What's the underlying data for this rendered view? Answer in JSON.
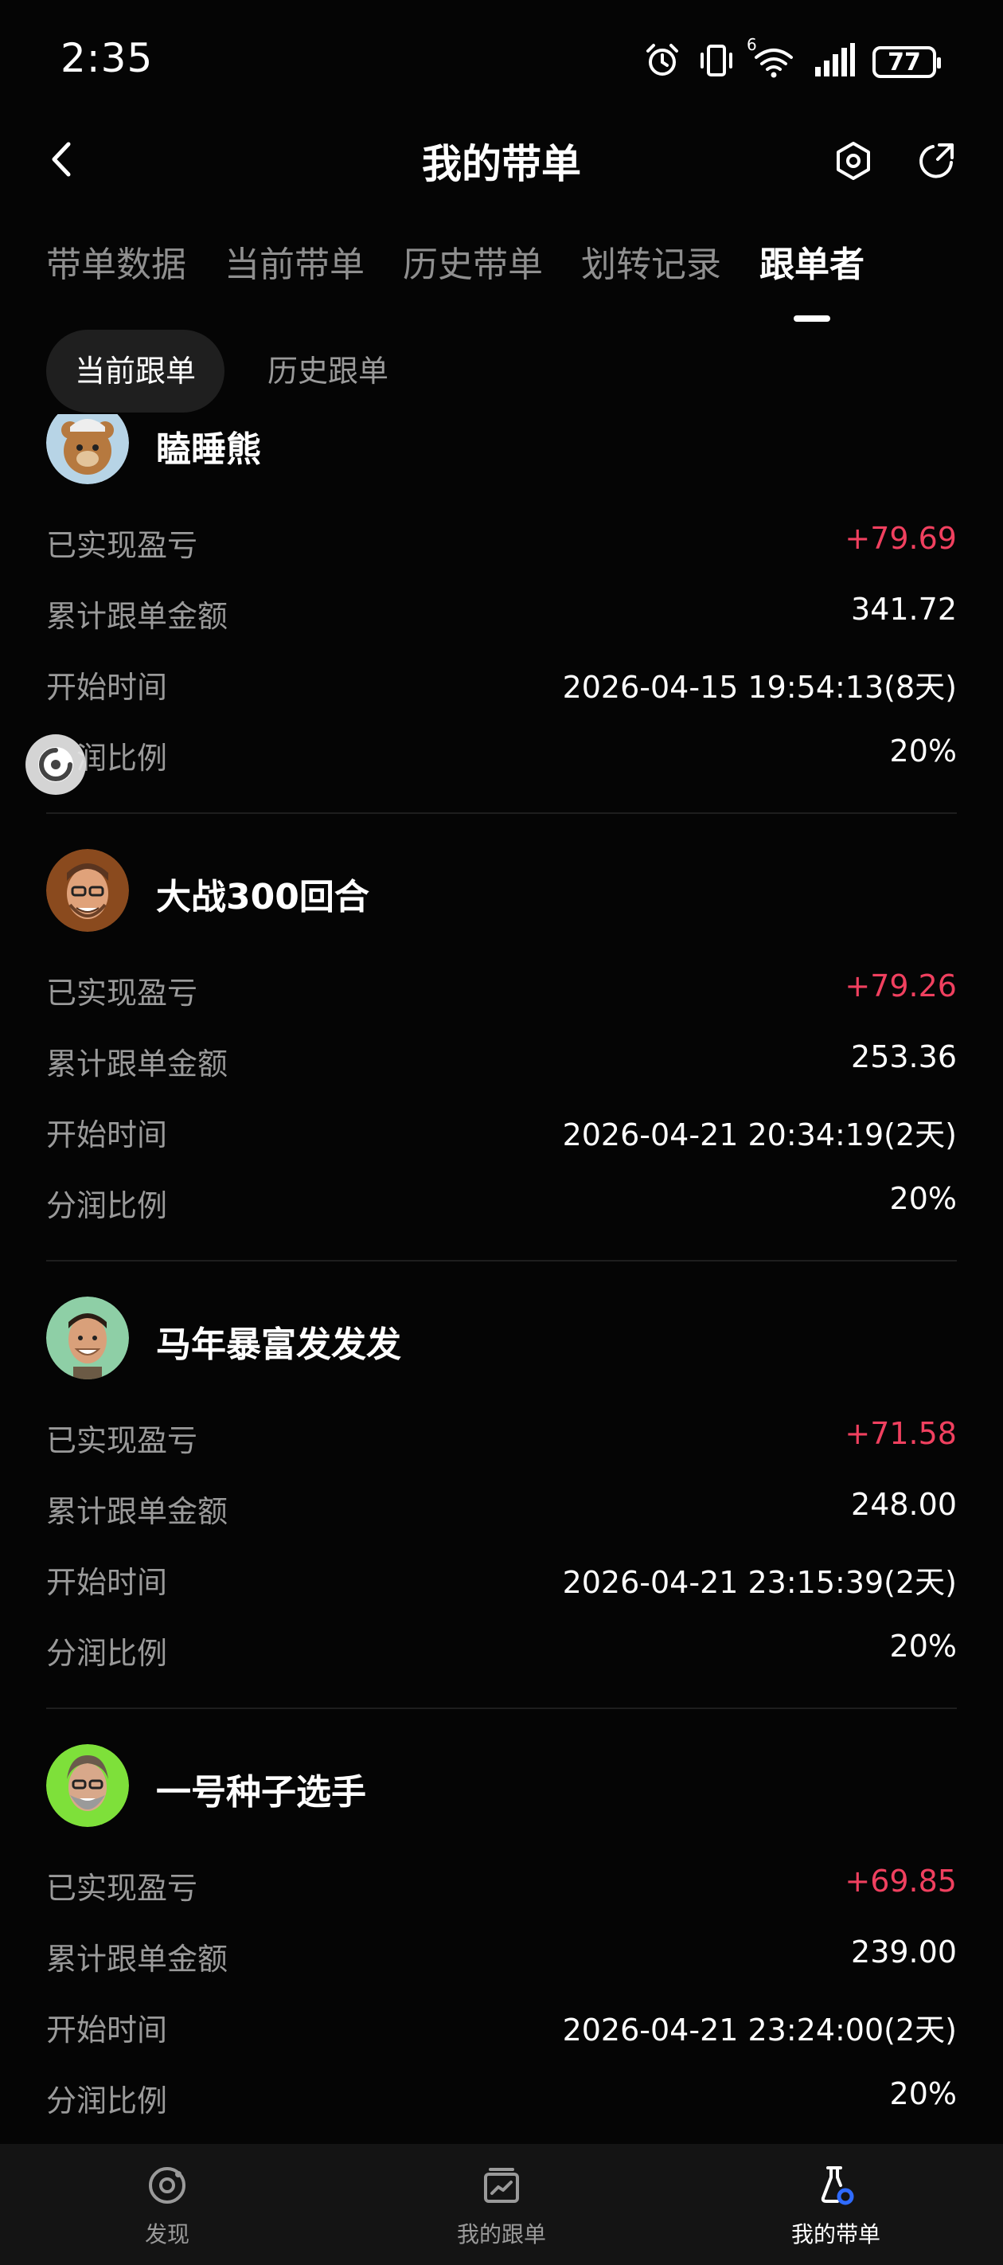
{
  "status": {
    "time": "2:35",
    "battery": "77",
    "net_badge": "6"
  },
  "header": {
    "title": "我的带单"
  },
  "tabs": [
    "带单数据",
    "当前带单",
    "历史带单",
    "划转记录",
    "跟单者"
  ],
  "active_tab": 4,
  "segments": [
    "当前跟单",
    "历史跟单"
  ],
  "active_segment": 0,
  "labels": {
    "pnl": "已实现盈亏",
    "amount": "累计跟单金额",
    "start": "开始时间",
    "share": "分润比例",
    "share_partial": "润比例"
  },
  "followers": [
    {
      "name": "瞌睡熊",
      "pnl": "+79.69",
      "amount": "341.72",
      "start": "2026-04-15 19:54:13(8天)",
      "share": "20%",
      "avatar_color": "#b7d4e6"
    },
    {
      "name": "大战300回合",
      "pnl": "+79.26",
      "amount": "253.36",
      "start": "2026-04-21 20:34:19(2天)",
      "share": "20%",
      "avatar_color": "#8a4a1e"
    },
    {
      "name": "马年暴富发发发",
      "pnl": "+71.58",
      "amount": "248.00",
      "start": "2026-04-21 23:15:39(2天)",
      "share": "20%",
      "avatar_color": "#8ecfa6"
    },
    {
      "name": "一号种子选手",
      "pnl": "+69.85",
      "amount": "239.00",
      "start": "2026-04-21 23:24:00(2天)",
      "share": "20%",
      "avatar_color": "#7ee03a"
    }
  ],
  "bottom_nav": [
    {
      "label": "发现",
      "icon": "discover-icon"
    },
    {
      "label": "我的跟单",
      "icon": "chart-box-icon"
    },
    {
      "label": "我的带单",
      "icon": "flask-icon"
    }
  ],
  "active_nav": 2,
  "colors": {
    "profit": "#f0405f",
    "background": "#050505",
    "nav_bg": "#141414"
  }
}
